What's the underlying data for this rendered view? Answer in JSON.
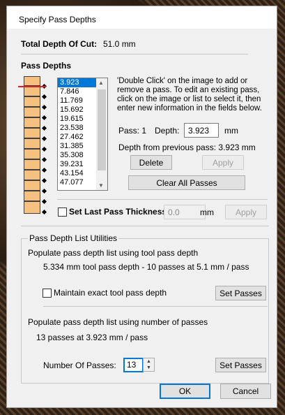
{
  "window": {
    "title": "Specify Pass Depths"
  },
  "total_depth": {
    "label": "Total Depth Of Cut:",
    "value": "51.0 mm"
  },
  "pass_depths": {
    "heading": "Pass Depths",
    "list": [
      "3.923",
      "7.846",
      "11.769",
      "15.692",
      "19.615",
      "23.538",
      "27.462",
      "31.385",
      "35.308",
      "39.231",
      "43.154",
      "47.077"
    ],
    "instructions": "'Double Click' on the image to add or remove a pass. To edit an existing pass, click on the image or list to select it, then enter new information in the fields below.",
    "pass_label": "Pass: 1",
    "depth_label": "Depth:",
    "depth_value": "3.923",
    "depth_unit": "mm",
    "from_previous": "Depth from previous pass:  3.923 mm",
    "delete": "Delete",
    "apply": "Apply",
    "clear_all": "Clear All Passes"
  },
  "last_pass": {
    "label": "Set Last Pass Thickness",
    "value": "0.0",
    "unit": "mm",
    "apply": "Apply"
  },
  "utilities": {
    "title": "Pass Depth List Utilities",
    "tool_heading": "Populate pass depth list using tool pass depth",
    "tool_summary": "5.334 mm tool pass depth - 10 passes at 5.1 mm / pass",
    "maintain_label": "Maintain exact tool pass depth",
    "set_passes": "Set Passes",
    "num_heading": "Populate pass depth list using number of passes",
    "num_summary": "13 passes at 3.923 mm / pass",
    "num_label": "Number Of Passes:",
    "num_value": "13",
    "set_passes2": "Set Passes"
  },
  "footer": {
    "ok": "OK",
    "cancel": "Cancel"
  }
}
